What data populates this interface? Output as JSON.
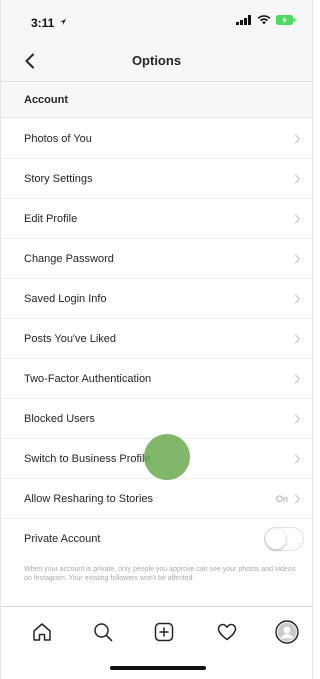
{
  "status_bar": {
    "time": "3:11"
  },
  "nav": {
    "title": "Options"
  },
  "section": {
    "title": "Account"
  },
  "rows": [
    {
      "label": "Photos of You"
    },
    {
      "label": "Story Settings"
    },
    {
      "label": "Edit Profile"
    },
    {
      "label": "Change Password"
    },
    {
      "label": "Saved Login Info"
    },
    {
      "label": "Posts You've Liked"
    },
    {
      "label": "Two-Factor Authentication"
    },
    {
      "label": "Blocked Users"
    },
    {
      "label": "Switch to Business Profile"
    },
    {
      "label": "Allow Resharing to Stories",
      "value": "On"
    },
    {
      "label": "Private Account",
      "toggle": false
    }
  ],
  "private_note": "When your account is private, only people you approve can see your photos and videos on Instagram. Your existing followers won't be affected.",
  "colors": {
    "text": "#262626",
    "muted": "#a0a0a0",
    "touch_indicator": "#6aaa50",
    "battery": "#4cd964"
  },
  "tab_bar": {
    "icons": [
      "home-icon",
      "search-icon",
      "add-post-icon",
      "activity-heart-icon",
      "profile-avatar-icon"
    ]
  }
}
